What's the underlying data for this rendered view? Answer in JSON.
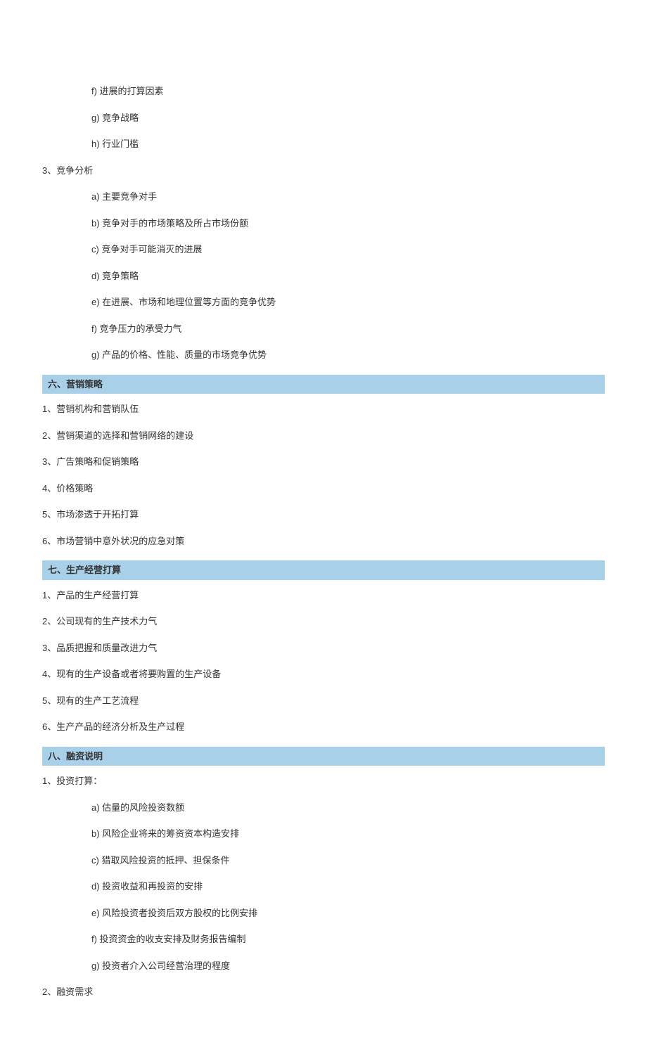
{
  "section5_sub2": {
    "f": "f)  进展的打算因素",
    "g": "g)  竞争战略",
    "h": "h)  行业门槛"
  },
  "section5_3": {
    "title": "3、竞争分析",
    "a": "a)  主要竞争对手",
    "b": "b)  竞争对手的市场策略及所占市场份额",
    "c": "c)  竞争对手可能消灭的进展",
    "d": "d)  竞争策略",
    "e": "e)  在进展、市场和地理位置等方面的竞争优势",
    "f": "f)  竞争压力的承受力气",
    "g": "g)  产品的价格、性能、质量的市场竞争优势"
  },
  "section6": {
    "header": "六、营销策略",
    "items": {
      "i1": "1、营销机构和营销队伍",
      "i2": "2、营销渠道的选择和营销网络的建设",
      "i3": "3、广告策略和促销策略",
      "i4": "4、价格策略",
      "i5": "5、市场渗透于开拓打算",
      "i6": "6、市场营销中意外状况的应急对策"
    }
  },
  "section7": {
    "header": "七、生产经营打算",
    "items": {
      "i1": "1、产品的生产经营打算",
      "i2": "2、公司现有的生产技术力气",
      "i3": "3、品质把握和质量改进力气",
      "i4": "4、现有的生产设备或者将要购置的生产设备",
      "i5": "5、现有的生产工艺流程",
      "i6": "6、生产产品的经济分析及生产过程"
    }
  },
  "section8": {
    "header": "八、融资说明",
    "item1": {
      "title": "1、投资打算：",
      "a": "a)  估量的风险投资数额",
      "b": "b)  风险企业将来的筹资资本构造安排",
      "c": "c)  猎取风险投资的抵押、担保条件",
      "d": "d)  投资收益和再投资的安排",
      "e": "e)  风险投资者投资后双方股权的比例安排",
      "f": "f)  投资资金的收支安排及财务报告编制",
      "g": "g)  投资者介入公司经营治理的程度"
    },
    "item2": "2、融资需求"
  }
}
